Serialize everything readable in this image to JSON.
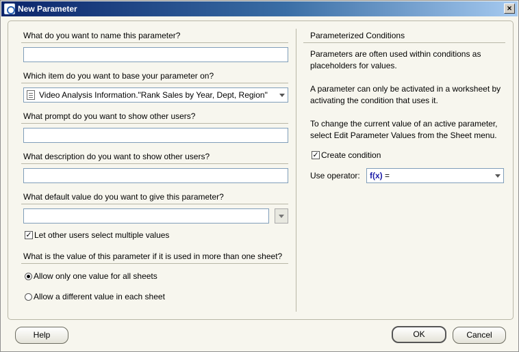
{
  "window": {
    "title": "New Parameter",
    "close_label": "×"
  },
  "left": {
    "name_prompt": "What do you want to name this parameter?",
    "name_value": "",
    "base_prompt": "Which item do you want to base your parameter on?",
    "base_value": "Video Analysis Information.\"Rank Sales by Year, Dept, Region\"",
    "prompt_prompt": "What prompt do you want to show other users?",
    "prompt_value": "",
    "description_prompt": "What description do you want to show other users?",
    "description_value": "",
    "default_prompt": "What default value do you want to give this parameter?",
    "default_value": "",
    "multiple_values_label": "Let other users select multiple values",
    "multiple_values_checked": true,
    "sheet_prompt": "What is the value of this parameter if it is used in more than one sheet?",
    "radio_one_label": "Allow only one value for all sheets",
    "radio_diff_label": "Allow a different value in each sheet",
    "radio_selected": "one"
  },
  "right": {
    "heading": "Parameterized Conditions",
    "para1": [
      "Parameters are often used within conditions as",
      "placeholders for values."
    ],
    "para2": [
      "A parameter can only be activated in a worksheet by",
      "activating the condition that uses it."
    ],
    "para3": [
      "To change the current value of an active parameter,",
      "select Edit Parameter Values from the Sheet menu."
    ],
    "create_condition_label": "Create condition",
    "create_condition_checked": true,
    "operator_label": "Use operator:",
    "operator_fx": "f(x)",
    "operator_value": "="
  },
  "buttons": {
    "help": "Help",
    "ok": "OK",
    "cancel": "Cancel"
  },
  "icons": {
    "app": "discoverer-app-icon",
    "close": "close-icon",
    "item": "document-icon",
    "dropdown": "chevron-down-icon",
    "check": "checkmark-icon"
  }
}
